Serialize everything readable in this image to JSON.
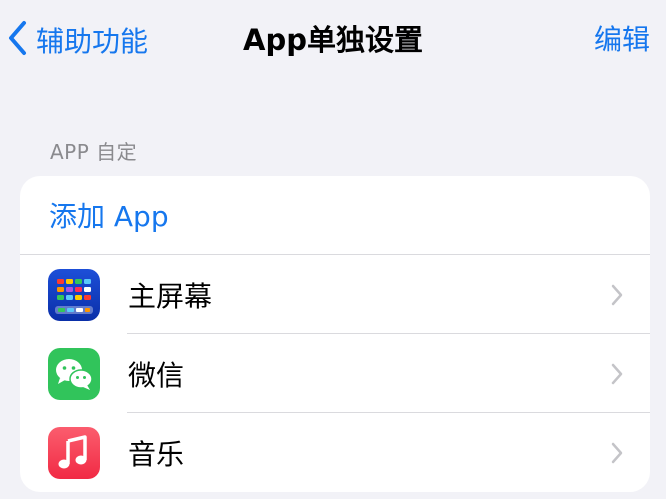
{
  "nav": {
    "back_label": "辅助功能",
    "title": "App单独设置",
    "edit_label": "编辑"
  },
  "section": {
    "header": "APP 自定"
  },
  "list": {
    "add_label": "添加 App",
    "apps": [
      {
        "label": "主屏幕",
        "icon": "home-screen-icon"
      },
      {
        "label": "微信",
        "icon": "wechat-icon"
      },
      {
        "label": "音乐",
        "icon": "music-icon"
      }
    ]
  },
  "colors": {
    "accent": "#1677ee",
    "background": "#f2f2f7",
    "secondary_text": "#8a8a8e",
    "wechat_green": "#31c45b",
    "music_red": "#f53a50",
    "home_blue": "#1d4fd8"
  }
}
